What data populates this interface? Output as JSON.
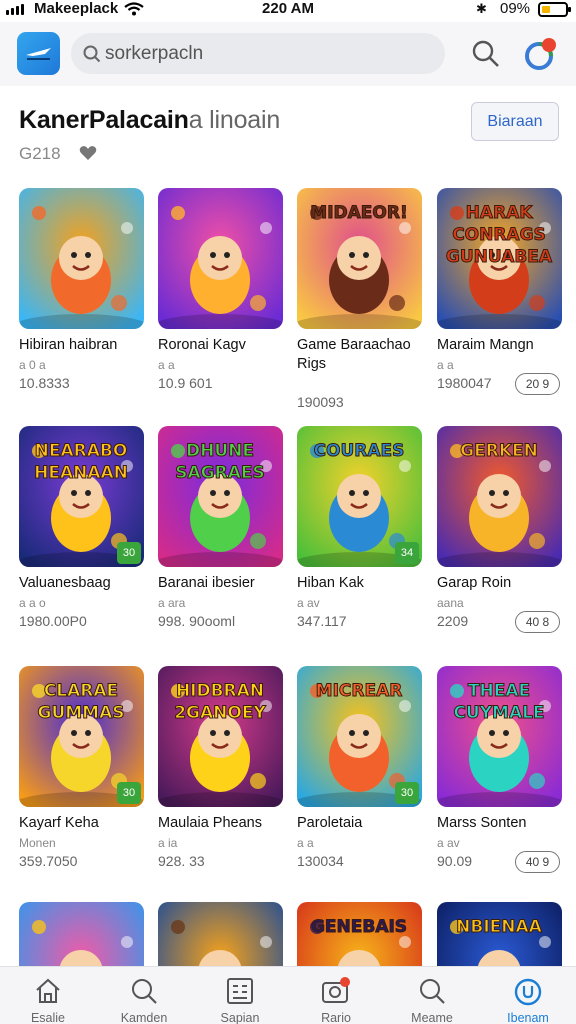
{
  "status": {
    "carrier": "Makeeplack",
    "time": "220 AM",
    "battery": "09%"
  },
  "header": {
    "search_placeholder": "sorkerpacln"
  },
  "title": {
    "bold": "KanerPalacain",
    "light": "a linoain",
    "count": "G218",
    "button": "Biaraan"
  },
  "games": [
    {
      "name": "Hibiran haibran",
      "sub": "a 0 a",
      "meta": "10.8333",
      "chip": ""
    },
    {
      "name": "Roronai Kagv",
      "sub": "a a",
      "meta": "10.9 601",
      "chip": ""
    },
    {
      "name": "Game Baraachao Rigs",
      "sub": "",
      "meta": "190093",
      "chip": ""
    },
    {
      "name": "Maraim Mangn",
      "sub": "a a",
      "meta": "1980047",
      "chip": "20 9"
    },
    {
      "name": "Valuanesbaag",
      "sub": "a a o",
      "meta": "1980.00P0",
      "chip": ""
    },
    {
      "name": "Baranai ibesier",
      "sub": "a ara",
      "meta": "998. 90ooml",
      "chip": ""
    },
    {
      "name": "Hiban Kak",
      "sub": "a av",
      "meta": "347.117",
      "chip": ""
    },
    {
      "name": "Garap Roin",
      "sub": "aana",
      "meta": "2209",
      "chip": "40 8"
    },
    {
      "name": "Kayarf Keha",
      "sub": "Monen",
      "meta": "359.7050",
      "chip": ""
    },
    {
      "name": "Maulaia Pheans",
      "sub": "a ia",
      "meta": "928. 33",
      "chip": ""
    },
    {
      "name": "Paroletaia",
      "sub": "a a",
      "meta": "130034",
      "chip": ""
    },
    {
      "name": "Marss Sonten",
      "sub": "a av",
      "meta": "90.09",
      "chip": "40 9"
    }
  ],
  "thumb_texts": [
    "",
    "",
    "MIDAEOR!",
    "HARAK CONRAGS GUNUABEA",
    "NEARABO HEANAAN",
    "DHUNE SAGRAES",
    "COURAES",
    "GERKEN",
    "CLARAE GUMMAS",
    "HIDBRAN 2GANOEY",
    "MICREAR",
    "THEAE CUYMALE",
    "",
    "",
    "GENEBAIS",
    "NBIENAA"
  ],
  "badges": [
    "",
    "",
    "",
    "",
    "30",
    "",
    "34",
    "",
    "30",
    "",
    "30",
    ""
  ],
  "nav": [
    "Esalie",
    "Kamden",
    "Sapian",
    "Rario",
    "Meame",
    "Ibenam"
  ],
  "colors": {
    "accent": "#1b7ed6",
    "notification": "#e8442f"
  }
}
